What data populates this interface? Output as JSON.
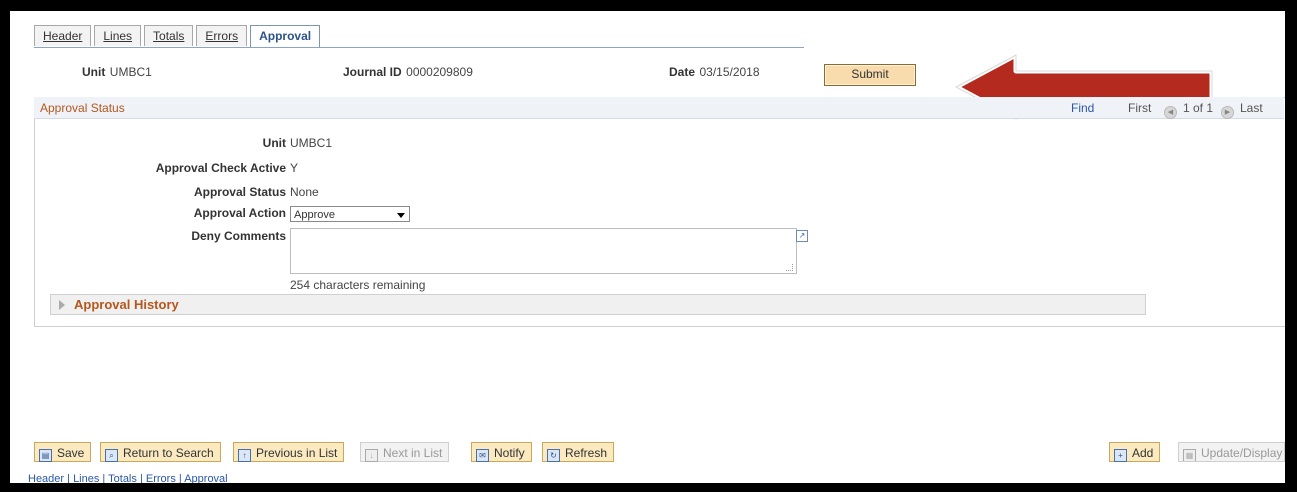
{
  "tabs": [
    {
      "label": "Header"
    },
    {
      "label": "Lines"
    },
    {
      "label": "Totals"
    },
    {
      "label": "Errors"
    },
    {
      "label": "Approval",
      "active": true
    }
  ],
  "header": {
    "unit_label": "Unit",
    "unit_value": "UMBC1",
    "journal_label": "Journal ID",
    "journal_value": "0000209809",
    "date_label": "Date",
    "date_value": "03/15/2018",
    "submit_label": "Submit"
  },
  "approval_status_group": {
    "title": "Approval Status",
    "find": "Find",
    "first": "First",
    "page_count": "1 of 1",
    "last": "Last"
  },
  "fields": {
    "unit_label": "Unit",
    "unit_value": "UMBC1",
    "check_active_label": "Approval Check Active",
    "check_active_value": "Y",
    "status_label": "Approval Status",
    "status_value": "None",
    "action_label": "Approval Action",
    "action_value": "Approve",
    "deny_label": "Deny Comments",
    "deny_value": "",
    "chars_remaining": "254 characters remaining"
  },
  "approval_history": {
    "label": "Approval History"
  },
  "toolbar": {
    "save": "Save",
    "return_to_search": "Return to Search",
    "previous_in_list": "Previous in List",
    "next_in_list": "Next in List",
    "notify": "Notify",
    "refresh": "Refresh",
    "add": "Add",
    "update_display": "Update/Display"
  },
  "footer_links": [
    "Header",
    "Lines",
    "Totals",
    "Errors",
    "Approval"
  ],
  "colors": {
    "accent_orange": "#b5571d",
    "link_blue": "#2a57a7",
    "button_fill": "#fbe9c0",
    "arrow_red": "#b52a1e"
  }
}
